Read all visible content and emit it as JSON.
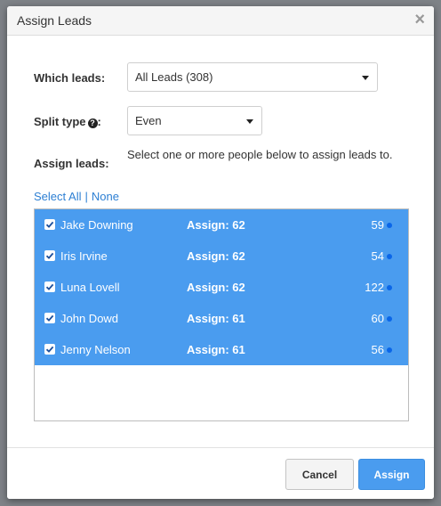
{
  "dialog": {
    "title": "Assign Leads",
    "close_glyph": "×"
  },
  "form": {
    "which_leads_label": "Which leads:",
    "which_leads_value": "All Leads (308)",
    "split_type_label": "Split type",
    "split_type_suffix": ":",
    "split_type_value": "Even",
    "assign_leads_label": "Assign leads:",
    "assign_help": "Select one or more people below to assign leads to."
  },
  "selection": {
    "select_all": "Select All",
    "separator": "|",
    "none": "None"
  },
  "people": [
    {
      "name": "Jake Downing",
      "assign": "Assign: 62",
      "count": "59",
      "checked": true
    },
    {
      "name": "Iris Irvine",
      "assign": "Assign: 62",
      "count": "54",
      "checked": true
    },
    {
      "name": "Luna Lovell",
      "assign": "Assign: 62",
      "count": "122",
      "checked": true
    },
    {
      "name": "John Dowd",
      "assign": "Assign: 61",
      "count": "60",
      "checked": true
    },
    {
      "name": "Jenny Nelson",
      "assign": "Assign: 61",
      "count": "56",
      "checked": true
    }
  ],
  "buttons": {
    "cancel": "Cancel",
    "assign": "Assign"
  },
  "colors": {
    "accent": "#4a9cef",
    "link": "#2d7fd3",
    "dot": "#0a66e8"
  },
  "icons": {
    "close": "close-icon",
    "help": "question-circle-icon",
    "caret": "caret-down-icon",
    "checkbox": "checkbox-checked-icon",
    "status_dot": "status-dot-icon"
  }
}
